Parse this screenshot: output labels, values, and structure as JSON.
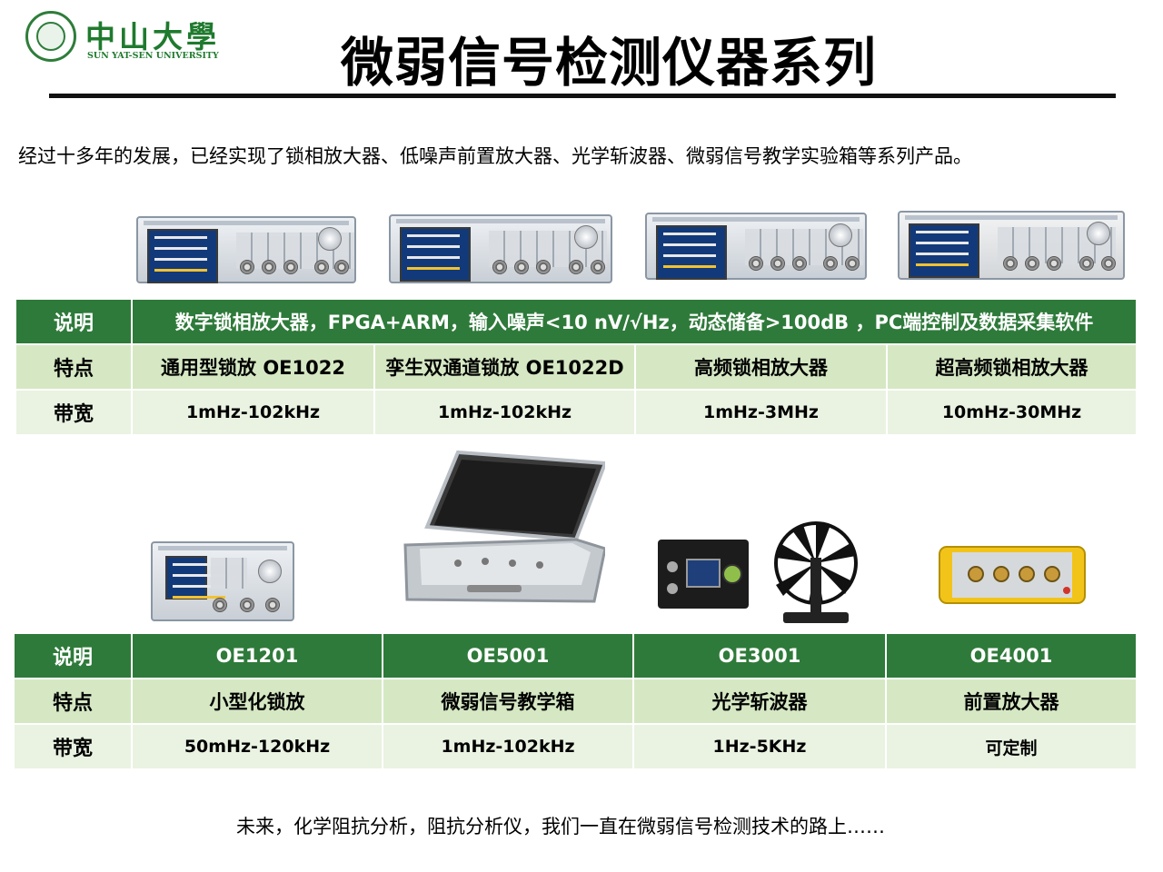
{
  "header": {
    "university_cn": "中山大學",
    "university_en": "SUN YAT-SEN UNIVERSITY",
    "title": "微弱信号检测仪器系列"
  },
  "intro": "经过十多年的发展，已经实现了锁相放大器、低噪声前置放大器、光学斩波器、微弱信号教学实验箱等系列产品。",
  "table1": {
    "row_labels": [
      "说明",
      "特点",
      "带宽"
    ],
    "description": "数字锁相放大器，FPGA+ARM，输入噪声<10 nV/√Hz，动态储备>100dB ，PC端控制及数据采集软件",
    "features": [
      "通用型锁放 OE1022",
      "孪生双通道锁放 OE1022D",
      "高频锁相放大器",
      "超高频锁相放大器"
    ],
    "bandwidths": [
      "1mHz-102kHz",
      "1mHz-102kHz",
      "1mHz-3MHz",
      "10mHz-30MHz"
    ]
  },
  "table2": {
    "row_labels": [
      "说明",
      "特点",
      "带宽"
    ],
    "models": [
      "OE1201",
      "OE5001",
      "OE3001",
      "OE4001"
    ],
    "features": [
      "小型化锁放",
      "微弱信号教学箱",
      "光学斩波器",
      "前置放大器"
    ],
    "bandwidths": [
      "50mHz-120kHz",
      "1mHz-102kHz",
      "1Hz-5KHz",
      "可定制"
    ]
  },
  "footer": "未来，化学阻抗分析，阻抗分析仪，我们一直在微弱信号检测技术的路上……",
  "colors": {
    "header_green": "#2e7a3a",
    "row_green": "#d5e8c3",
    "row_light": "#eaf3e2",
    "logo_green": "#1f7a2e"
  }
}
